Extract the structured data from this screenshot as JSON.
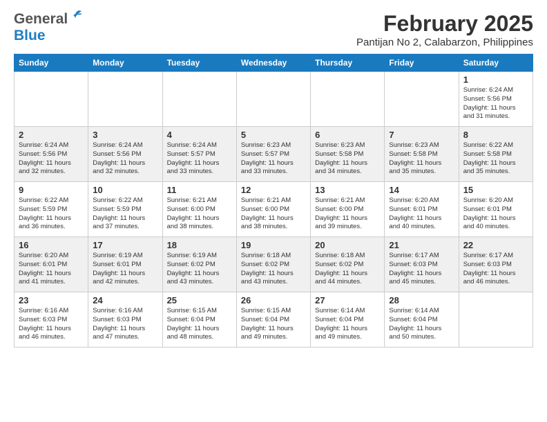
{
  "header": {
    "logo_general": "General",
    "logo_blue": "Blue",
    "month_title": "February 2025",
    "location": "Pantijan No 2, Calabarzon, Philippines"
  },
  "days_of_week": [
    "Sunday",
    "Monday",
    "Tuesday",
    "Wednesday",
    "Thursday",
    "Friday",
    "Saturday"
  ],
  "weeks": [
    [
      {
        "day": "",
        "info": ""
      },
      {
        "day": "",
        "info": ""
      },
      {
        "day": "",
        "info": ""
      },
      {
        "day": "",
        "info": ""
      },
      {
        "day": "",
        "info": ""
      },
      {
        "day": "",
        "info": ""
      },
      {
        "day": "1",
        "info": "Sunrise: 6:24 AM\nSunset: 5:56 PM\nDaylight: 11 hours and 31 minutes."
      }
    ],
    [
      {
        "day": "2",
        "info": "Sunrise: 6:24 AM\nSunset: 5:56 PM\nDaylight: 11 hours and 32 minutes."
      },
      {
        "day": "3",
        "info": "Sunrise: 6:24 AM\nSunset: 5:56 PM\nDaylight: 11 hours and 32 minutes."
      },
      {
        "day": "4",
        "info": "Sunrise: 6:24 AM\nSunset: 5:57 PM\nDaylight: 11 hours and 33 minutes."
      },
      {
        "day": "5",
        "info": "Sunrise: 6:23 AM\nSunset: 5:57 PM\nDaylight: 11 hours and 33 minutes."
      },
      {
        "day": "6",
        "info": "Sunrise: 6:23 AM\nSunset: 5:58 PM\nDaylight: 11 hours and 34 minutes."
      },
      {
        "day": "7",
        "info": "Sunrise: 6:23 AM\nSunset: 5:58 PM\nDaylight: 11 hours and 35 minutes."
      },
      {
        "day": "8",
        "info": "Sunrise: 6:22 AM\nSunset: 5:58 PM\nDaylight: 11 hours and 35 minutes."
      }
    ],
    [
      {
        "day": "9",
        "info": "Sunrise: 6:22 AM\nSunset: 5:59 PM\nDaylight: 11 hours and 36 minutes."
      },
      {
        "day": "10",
        "info": "Sunrise: 6:22 AM\nSunset: 5:59 PM\nDaylight: 11 hours and 37 minutes."
      },
      {
        "day": "11",
        "info": "Sunrise: 6:21 AM\nSunset: 6:00 PM\nDaylight: 11 hours and 38 minutes."
      },
      {
        "day": "12",
        "info": "Sunrise: 6:21 AM\nSunset: 6:00 PM\nDaylight: 11 hours and 38 minutes."
      },
      {
        "day": "13",
        "info": "Sunrise: 6:21 AM\nSunset: 6:00 PM\nDaylight: 11 hours and 39 minutes."
      },
      {
        "day": "14",
        "info": "Sunrise: 6:20 AM\nSunset: 6:01 PM\nDaylight: 11 hours and 40 minutes."
      },
      {
        "day": "15",
        "info": "Sunrise: 6:20 AM\nSunset: 6:01 PM\nDaylight: 11 hours and 40 minutes."
      }
    ],
    [
      {
        "day": "16",
        "info": "Sunrise: 6:20 AM\nSunset: 6:01 PM\nDaylight: 11 hours and 41 minutes."
      },
      {
        "day": "17",
        "info": "Sunrise: 6:19 AM\nSunset: 6:01 PM\nDaylight: 11 hours and 42 minutes."
      },
      {
        "day": "18",
        "info": "Sunrise: 6:19 AM\nSunset: 6:02 PM\nDaylight: 11 hours and 43 minutes."
      },
      {
        "day": "19",
        "info": "Sunrise: 6:18 AM\nSunset: 6:02 PM\nDaylight: 11 hours and 43 minutes."
      },
      {
        "day": "20",
        "info": "Sunrise: 6:18 AM\nSunset: 6:02 PM\nDaylight: 11 hours and 44 minutes."
      },
      {
        "day": "21",
        "info": "Sunrise: 6:17 AM\nSunset: 6:03 PM\nDaylight: 11 hours and 45 minutes."
      },
      {
        "day": "22",
        "info": "Sunrise: 6:17 AM\nSunset: 6:03 PM\nDaylight: 11 hours and 46 minutes."
      }
    ],
    [
      {
        "day": "23",
        "info": "Sunrise: 6:16 AM\nSunset: 6:03 PM\nDaylight: 11 hours and 46 minutes."
      },
      {
        "day": "24",
        "info": "Sunrise: 6:16 AM\nSunset: 6:03 PM\nDaylight: 11 hours and 47 minutes."
      },
      {
        "day": "25",
        "info": "Sunrise: 6:15 AM\nSunset: 6:04 PM\nDaylight: 11 hours and 48 minutes."
      },
      {
        "day": "26",
        "info": "Sunrise: 6:15 AM\nSunset: 6:04 PM\nDaylight: 11 hours and 49 minutes."
      },
      {
        "day": "27",
        "info": "Sunrise: 6:14 AM\nSunset: 6:04 PM\nDaylight: 11 hours and 49 minutes."
      },
      {
        "day": "28",
        "info": "Sunrise: 6:14 AM\nSunset: 6:04 PM\nDaylight: 11 hours and 50 minutes."
      },
      {
        "day": "",
        "info": ""
      }
    ]
  ]
}
